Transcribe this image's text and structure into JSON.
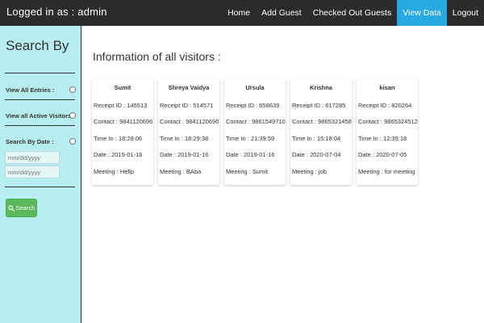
{
  "navbar": {
    "brand": "Logged in as : admin",
    "links": [
      {
        "label": "Home"
      },
      {
        "label": "Add Guest"
      },
      {
        "label": "Checked Out Guests"
      },
      {
        "label": "View Data"
      },
      {
        "label": "Logout"
      }
    ]
  },
  "sidebar": {
    "title": "Search By",
    "view_all_label": "View All Entries :",
    "view_active_label": "View all Active Visitors :",
    "search_date_label": "Search By Date :",
    "date_from_placeholder": "mm/dd/yyyy",
    "date_to_placeholder": "mm/dd/yyyy",
    "search_button": "Search"
  },
  "main": {
    "title": "Information of all visitors :",
    "visitors": [
      {
        "name": "Sumit",
        "receipt": "Receipt ID : 145513",
        "contact": "Contact : 9841120696",
        "time_in": "Time In : 18:28:06",
        "date": "Date : 2019-01-16",
        "meeting": "Meeting : Hellp"
      },
      {
        "name": "Shreya Vaidya",
        "receipt": "Receipt ID : 514571",
        "contact": "Contact : 9841120696",
        "time_in": "Time In : 18:29:38",
        "date": "Date : 2019-01-16",
        "meeting": "Meeting : BAba"
      },
      {
        "name": "Ursula",
        "receipt": "Receipt ID : 658639",
        "contact": "Contact : 9861549710",
        "time_in": "Time In : 21:39:59",
        "date": "Date : 2019-01-16",
        "meeting": "Meeting : Sumit"
      },
      {
        "name": "Krishna",
        "receipt": "Receipt ID : 617285",
        "contact": "Contact : 9865321458",
        "time_in": "Time In : 15:18:04",
        "date": "Date : 2020-07-04",
        "meeting": "Meeting : job"
      },
      {
        "name": "kisan",
        "receipt": "Receipt ID : 820264",
        "contact": "Contact : 9865324512",
        "time_in": "Time In : 12:35:18",
        "date": "Date : 2020-07-05",
        "meeting": "Meeting : for meeting"
      }
    ]
  },
  "colors": {
    "navbar_bg": "#2b2b2b",
    "active_tab": "#27a9e1",
    "sidebar_bg": "#b6eef2",
    "search_button": "#5cb85c"
  },
  "icons": {
    "search_button_icon": "search-icon"
  }
}
